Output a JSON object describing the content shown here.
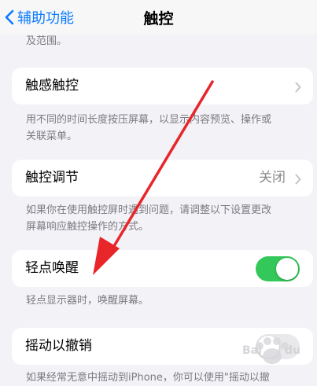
{
  "nav": {
    "back_label": "辅助功能",
    "title": "触控"
  },
  "intro_text": "及范围。",
  "sections": {
    "haptic": {
      "label": "触感触控",
      "description_line1": "用不同的时间长度按压屏幕，以显示内容预览、操作或",
      "description_line2": "关联菜单。"
    },
    "touch_accommodations": {
      "label": "触控调节",
      "value": "关闭",
      "description_line1": "如果你在使用触控屏时遇到问题，请调整以下设置更改",
      "description_line2": "屏幕响应触控操作的方式。"
    },
    "tap_to_wake": {
      "label": "轻点唤醒",
      "toggle_on": true,
      "description": "轻点显示器时，唤醒屏幕。"
    },
    "shake_to_undo": {
      "label": "摇动以撤销",
      "toggle_on": false,
      "description_partial": "如果经常无意中摇动到iPhone，你可以使用\"摇动以撤"
    }
  },
  "watermark_text": "Bai du 经验",
  "colors": {
    "accent_blue": "#0a7aff",
    "toggle_green": "#34c759",
    "toggle_off": "#e9e9eb",
    "arrow_red": "#e8262a",
    "background": "#f2f2f7"
  },
  "icons": {
    "back": "chevron-left-icon",
    "disclosure": "chevron-right-icon",
    "annotation": "red-arrow-annotation"
  }
}
